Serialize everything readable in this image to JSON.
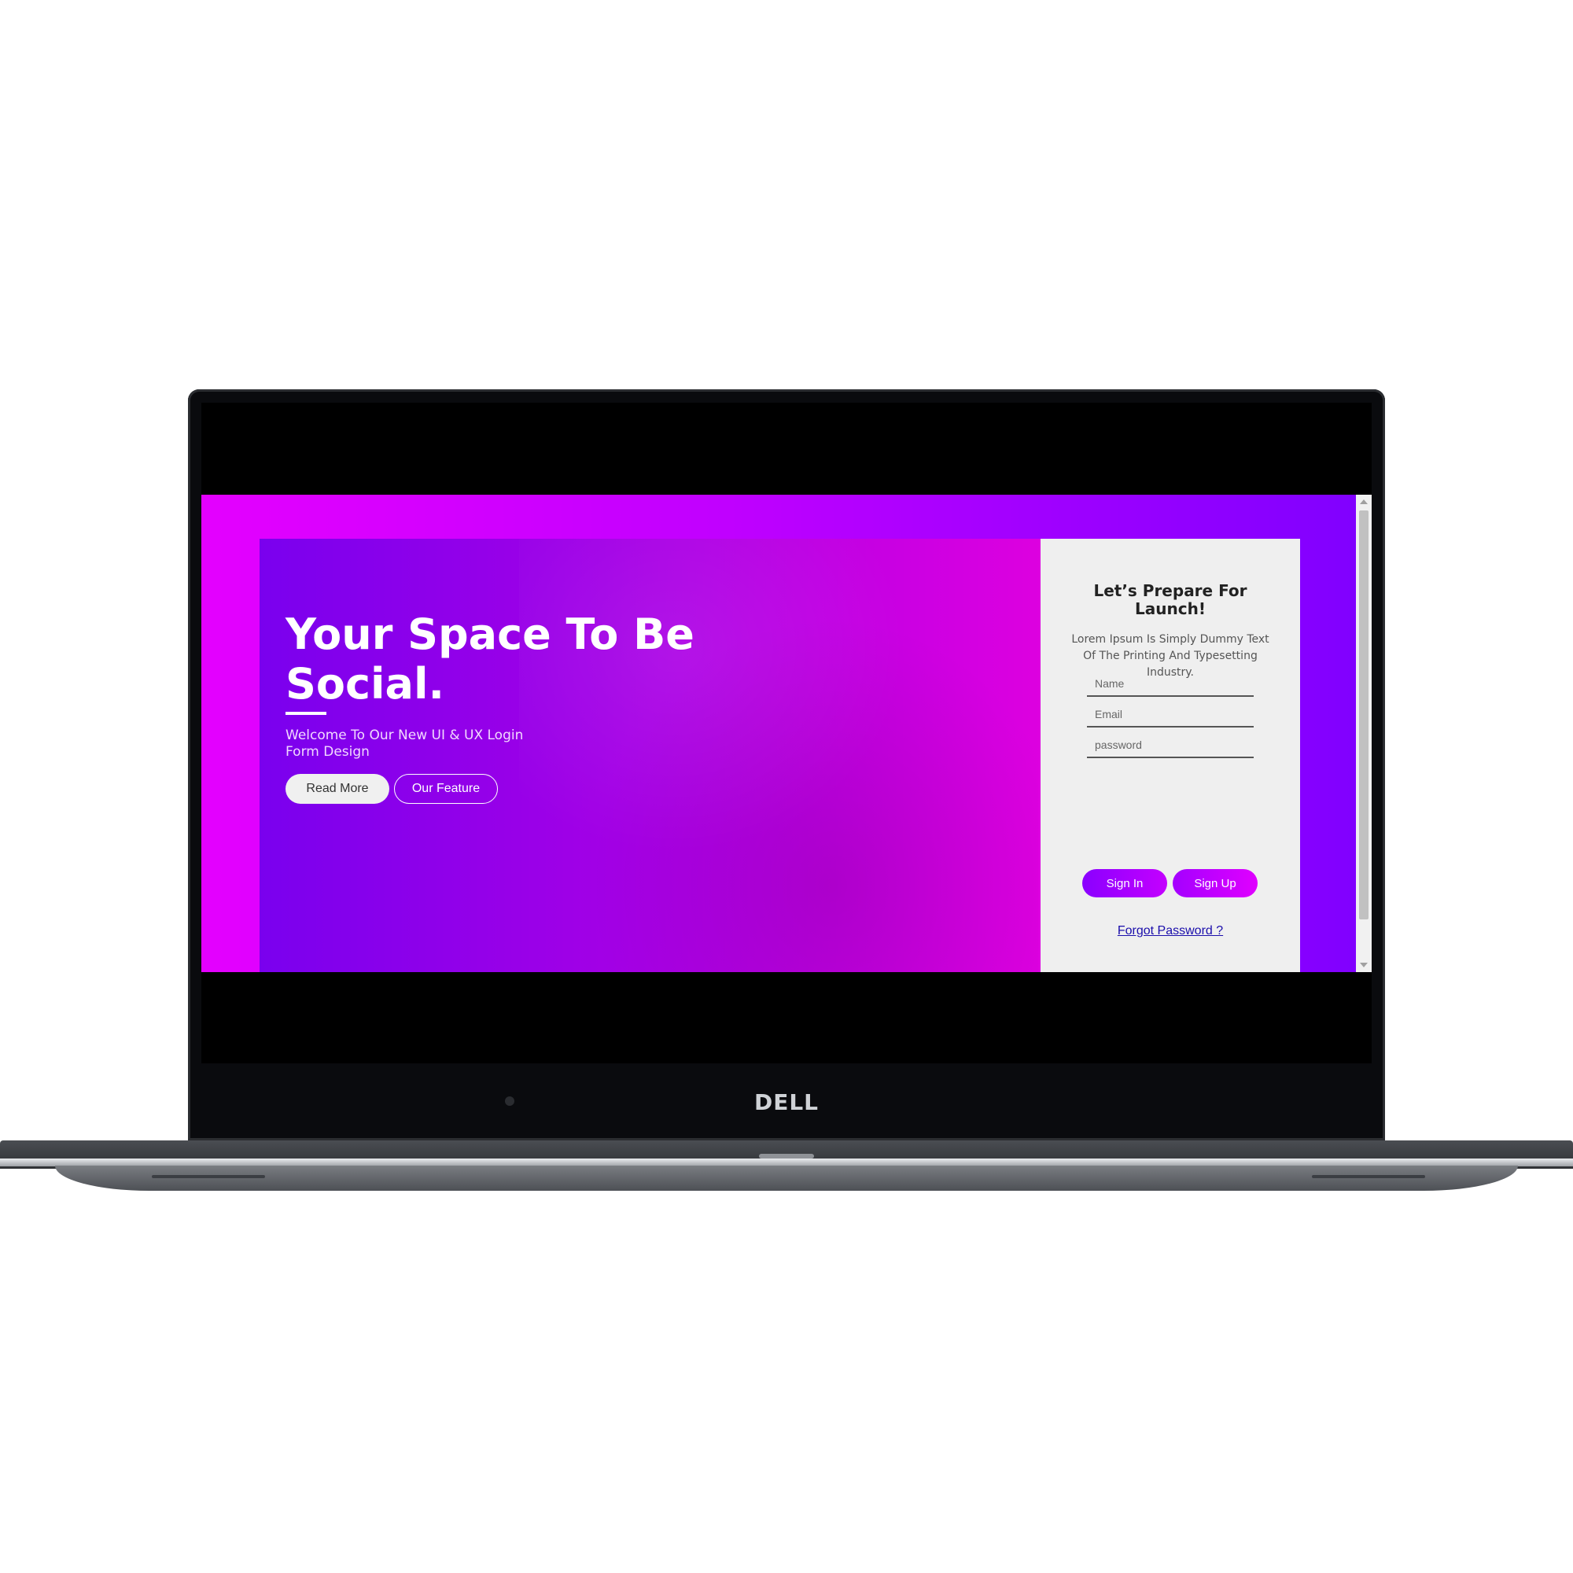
{
  "device": {
    "brand": "DELL"
  },
  "hero": {
    "title": "Your Space To Be Social.",
    "subtitle": "Welcome To Our New UI & UX Login Form Design",
    "read_more_label": "Read More",
    "our_feature_label": "Our Feature"
  },
  "panel": {
    "title": "Let’s Prepare For Launch!",
    "text": "Lorem Ipsum Is Simply Dummy Text Of The Printing And Typesetting Industry.",
    "fields": {
      "name_placeholder": "Name",
      "email_placeholder": "Email",
      "password_placeholder": "password"
    },
    "sign_in_label": "Sign In",
    "sign_up_label": "Sign Up",
    "forgot_label": "Forgot Password ?"
  },
  "colors": {
    "page_gradient_start": "#e400ff",
    "page_gradient_end": "#7f00ff",
    "hero_gradient_start": "#7a00ee",
    "hero_gradient_end": "#dd00e0",
    "panel_bg": "#efefef"
  }
}
